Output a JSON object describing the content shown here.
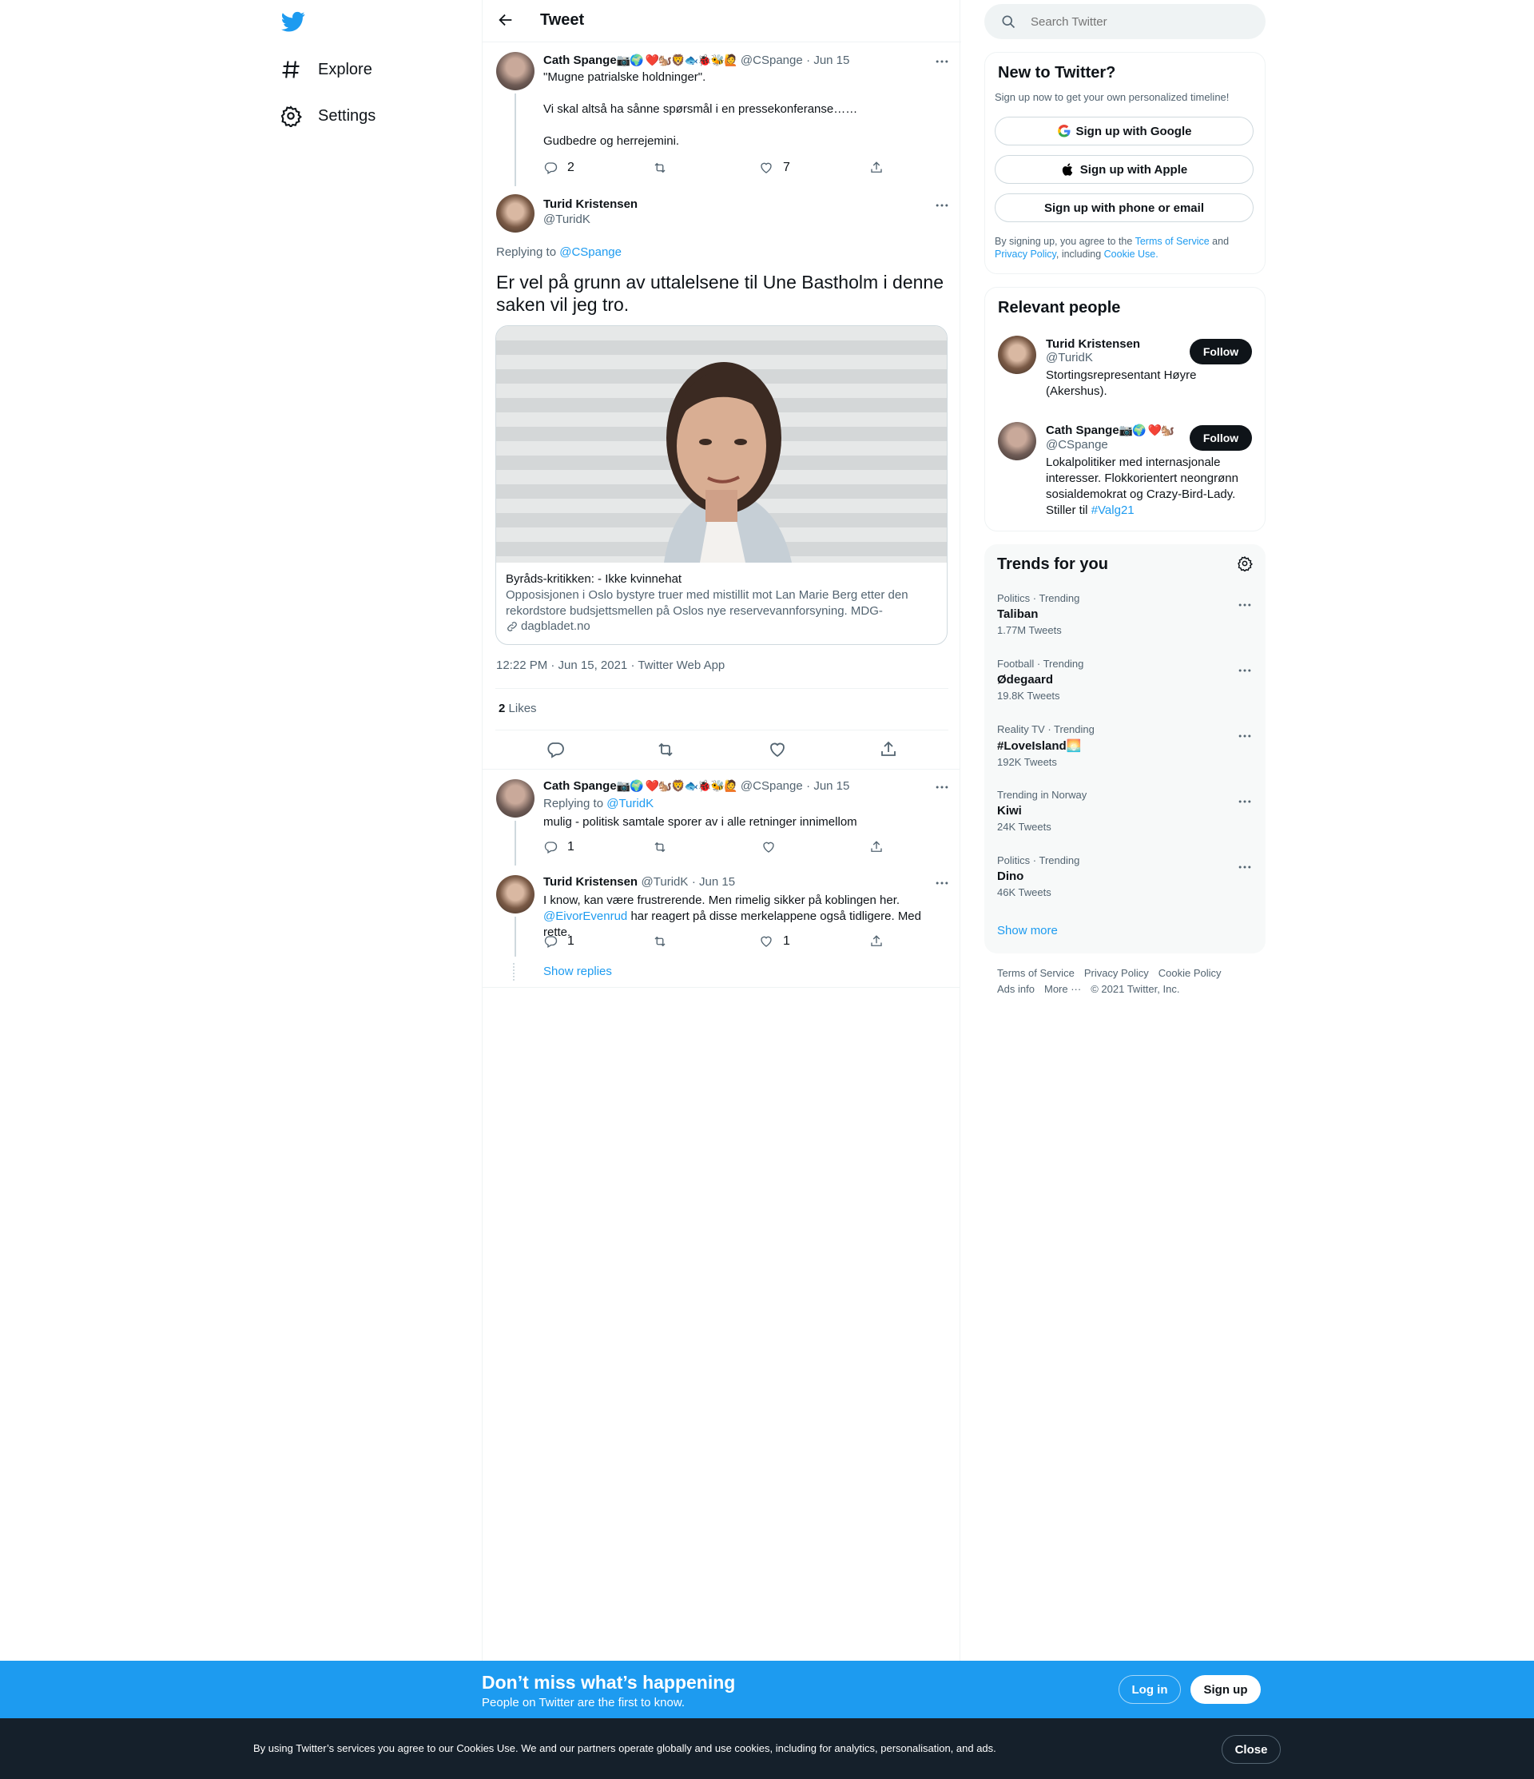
{
  "nav": {
    "explore": "Explore",
    "settings": "Settings"
  },
  "header": {
    "title": "Tweet"
  },
  "tweet1": {
    "name": "Cath Spange",
    "emojis": "📷🌍 ❤️🐿️🦁🐟🐞🐝🙋",
    "handle": "@CSpange",
    "date": "· Jun 15",
    "lines": [
      "\"Mugne patrialske holdninger\".",
      "Vi skal altså ha sånne spørsmål i en pressekonferanse……",
      "Gudbedre og herrejemini."
    ],
    "replies": "2",
    "likes": "7"
  },
  "main_tweet": {
    "name": "Turid Kristensen",
    "handle": "@TuridK",
    "replying_prefix": "Replying to",
    "replying_to": "@CSpange",
    "text": "Er vel på grunn av uttalelsene til Une Bastholm i denne saken vil jeg tro.",
    "card_title": "Byråds-kritikken: - Ikke kvinnehat",
    "card_desc": "Opposisjonen i Oslo bystyre truer med mistillit mot Lan Marie Berg etter den rekordstore budsjettsmellen på Oslos nye reservevannforsyning. MDG-kollegaer...",
    "card_domain": "dagbladet.no",
    "timestamp": "12:22 PM · Jun 15, 2021 · Twitter Web App",
    "likes_count": "2",
    "likes_label": "Likes"
  },
  "reply1": {
    "name": "Cath Spange",
    "emojis": "📷🌍 ❤️🐿️🦁🐟🐞🐝🙋",
    "handle": "@CSpange",
    "date": "· Jun 15",
    "replying_prefix": "Replying to",
    "replying_to": "@TuridK",
    "text": "mulig - politisk samtale sporer av i alle retninger innimellom",
    "replies": "1"
  },
  "reply2": {
    "name": "Turid Kristensen",
    "handle": "@TuridK",
    "date": "· Jun 15",
    "line1": "I know, kan være frustrerende. Men rimelig sikker på koblingen her.",
    "mention": "@EivorEvenrud",
    "line2": " har reagert på disse merkelappene også tidligere. Med rette.",
    "replies": "1",
    "likes": "1",
    "show_replies": "Show replies"
  },
  "search": {
    "placeholder": "Search Twitter"
  },
  "new_to_twitter": {
    "title": "New to Twitter?",
    "subtitle": "Sign up now to get your own personalized timeline!",
    "google": "Sign up with Google",
    "apple": "Sign up with Apple",
    "phone": "Sign up with phone or email",
    "legal_1": "By signing up, you agree to the ",
    "tos": "Terms of Service",
    "legal_2": " and",
    "privacy": "Privacy Policy",
    "legal_3": ", including ",
    "cookie": "Cookie Use."
  },
  "relevant": {
    "title": "Relevant people",
    "people": [
      {
        "name": "Turid Kristensen",
        "handle": "@TuridK",
        "bio": "Stortingsrepresentant Høyre (Akershus).",
        "follow": "Follow"
      },
      {
        "name": "Cath Spange",
        "emojis": "📷🌍 ❤️🐿️",
        "handle": "@CSpange",
        "bio_pre": "Lokalpolitiker med internasjonale interesser. Flokkorientert neongrønn sosialdemokrat og Crazy-Bird-Lady. Stiller til ",
        "bio_tag": "#Valg21",
        "follow": "Follow"
      }
    ]
  },
  "trends": {
    "title": "Trends for you",
    "items": [
      {
        "meta": "Politics · Trending",
        "name": "Taliban",
        "count": "1.77M Tweets"
      },
      {
        "meta": "Football · Trending",
        "name": "Ødegaard",
        "count": "19.8K Tweets"
      },
      {
        "meta": "Reality TV · Trending",
        "name": "#LoveIsland🌅",
        "count": "192K Tweets"
      },
      {
        "meta": "Trending in Norway",
        "name": "Kiwi",
        "count": "24K Tweets"
      },
      {
        "meta": "Politics · Trending",
        "name": "Dino",
        "count": "46K Tweets"
      }
    ],
    "show_more": "Show more"
  },
  "footer": {
    "tos": "Terms of Service",
    "privacy": "Privacy Policy",
    "cookie": "Cookie Policy",
    "ads": "Ads info",
    "more": "More ···",
    "copyright": "© 2021 Twitter, Inc."
  },
  "signup_bar": {
    "title": "Don’t miss what’s happening",
    "subtitle": "People on Twitter are the first to know.",
    "login": "Log in",
    "signup": "Sign up"
  },
  "cookie_bar": {
    "text": "By using Twitter’s services you agree to our Cookies Use. We and our partners operate globally and use cookies, including for analytics, personalisation, and ads.",
    "close": "Close"
  },
  "colors": {
    "accent": "#1d9bf0",
    "text": "#0f1419",
    "muted": "#536471",
    "border": "#eff3f4"
  }
}
